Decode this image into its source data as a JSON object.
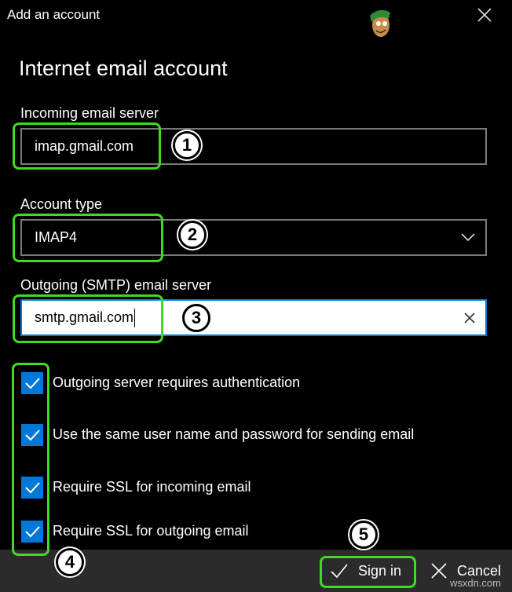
{
  "window": {
    "title": "Add an account"
  },
  "heading": "Internet email account",
  "incoming": {
    "label": "Incoming email server",
    "value": "imap.gmail.com"
  },
  "account_type": {
    "label": "Account type",
    "value": "IMAP4"
  },
  "outgoing": {
    "label": "Outgoing (SMTP) email server",
    "value": "smtp.gmail.com"
  },
  "checkboxes": [
    {
      "label": "Outgoing server requires authentication",
      "checked": true
    },
    {
      "label": "Use the same user name and password for sending email",
      "checked": true
    },
    {
      "label": "Require SSL for incoming email",
      "checked": true
    },
    {
      "label": "Require SSL for outgoing email",
      "checked": true
    }
  ],
  "buttons": {
    "sign_in": "Sign in",
    "cancel": "Cancel"
  },
  "annotations": [
    "1",
    "2",
    "3",
    "4",
    "5"
  ],
  "watermark": "wsxdn.com",
  "colors": {
    "accent": "#0078d7",
    "highlight": "#3fdb22",
    "footer": "#2b2b2b"
  }
}
